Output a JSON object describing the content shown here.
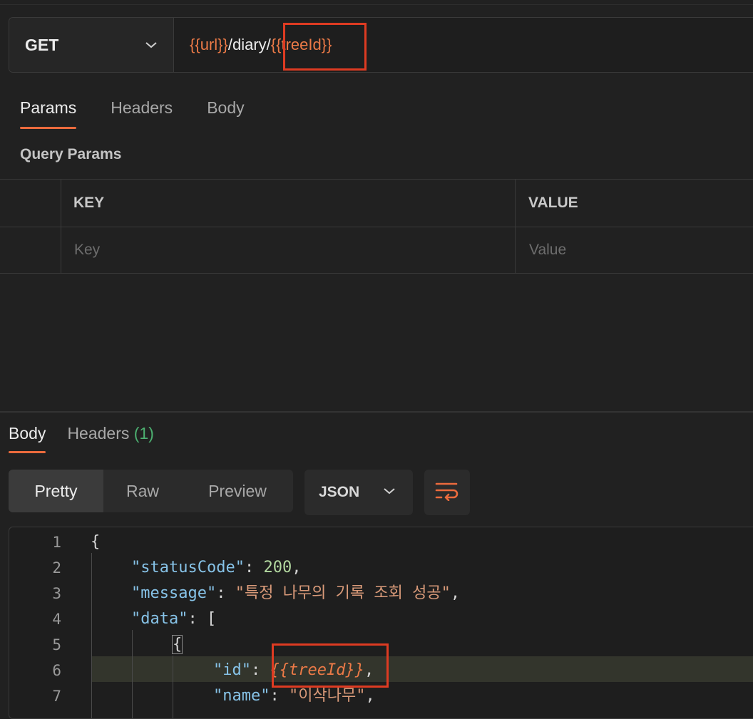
{
  "request": {
    "method": "GET",
    "url_parts": [
      {
        "text": "{{url}}",
        "kind": "variable"
      },
      {
        "text": "/diary/",
        "kind": "plain"
      },
      {
        "text": "{{treeId}}",
        "kind": "variable"
      }
    ]
  },
  "request_tabs": [
    "Params",
    "Headers",
    "Body"
  ],
  "query_params": {
    "title": "Query Params",
    "columns": [
      "KEY",
      "VALUE"
    ],
    "placeholders": {
      "key": "Key",
      "value": "Value"
    }
  },
  "response": {
    "tabs": {
      "body": "Body",
      "headers": "Headers",
      "headers_count": "(1)"
    },
    "view_modes": [
      "Pretty",
      "Raw",
      "Preview"
    ],
    "format": "JSON",
    "line_numbers": [
      "1",
      "2",
      "3",
      "4",
      "5",
      "6",
      "7"
    ],
    "code": {
      "l1_brace": "{",
      "status_key": "\"statusCode\"",
      "status_val": "200",
      "message_key": "\"message\"",
      "message_val": "\"특정 나무의 기록 조회 성공\"",
      "data_key": "\"data\"",
      "data_open": "[",
      "l5_brace": "{",
      "id_key": "\"id\"",
      "id_val": "{{treeId}}",
      "name_key": "\"name\"",
      "name_val": "\"이삭나무\""
    }
  },
  "colors": {
    "accent": "#ec6b3d",
    "variable": "#ec7a47",
    "highlight_box": "#de3b22",
    "json_key": "#87c3e8",
    "json_string": "#d99a79",
    "json_number": "#b3d9a0"
  }
}
